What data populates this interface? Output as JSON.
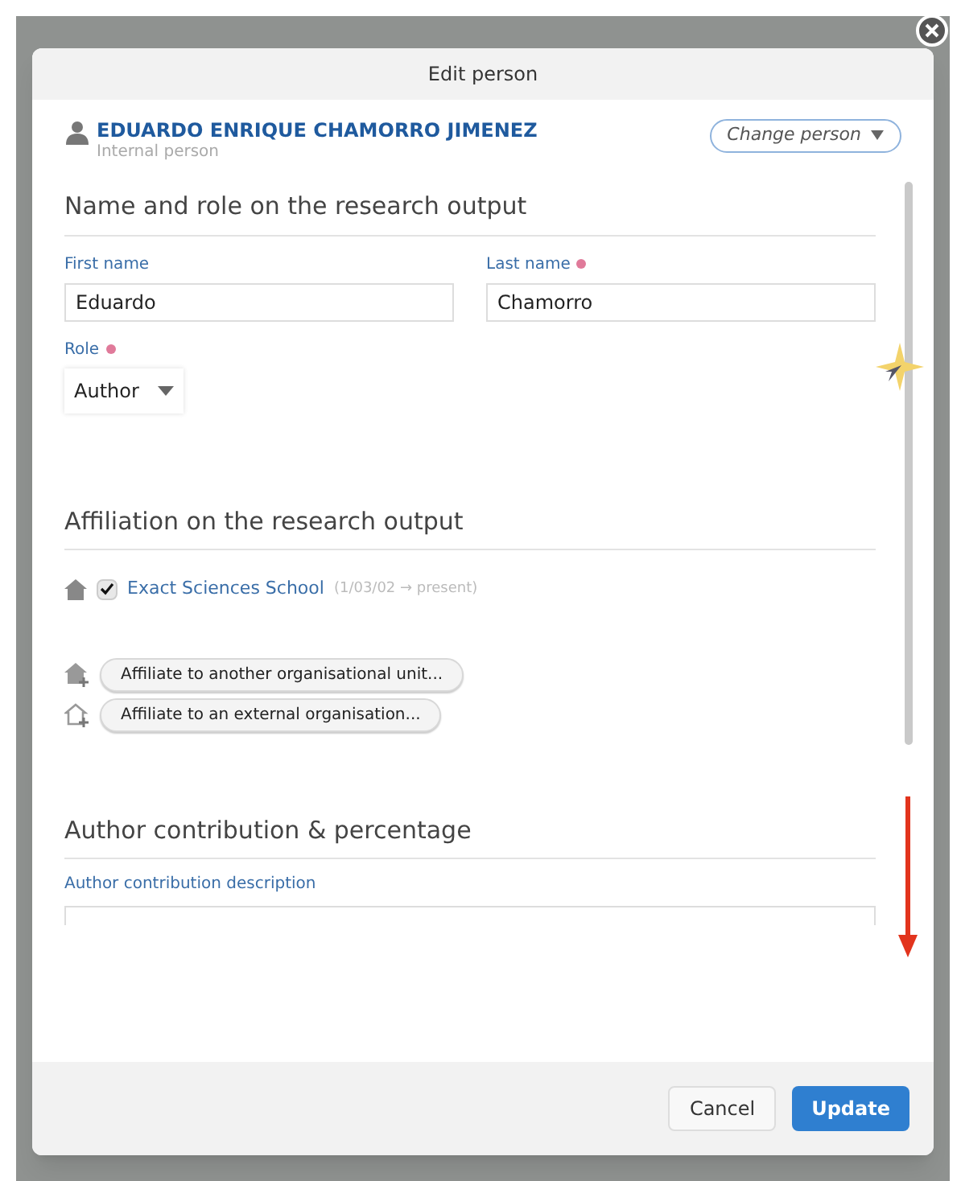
{
  "dialog": {
    "title": "Edit person"
  },
  "person": {
    "name": "EDUARDO ENRIQUE CHAMORRO JIMENEZ",
    "subtitle": "Internal person",
    "change_button": "Change person"
  },
  "name_section": {
    "heading": "Name and role on the research output",
    "fields": [
      {
        "label": "First name",
        "value": "Eduardo",
        "required": false
      },
      {
        "label": "Last name",
        "value": "Chamorro",
        "required": true
      }
    ],
    "role": {
      "label": "Role",
      "value": "Author",
      "required": true
    }
  },
  "affiliation_section": {
    "heading": "Affiliation on the research output",
    "affiliations": [
      {
        "name": "Exact Sciences School",
        "period": "(1/03/02 → present)",
        "checked": true
      }
    ],
    "actions": [
      {
        "kind": "internal",
        "label": "Affiliate to another organisational unit..."
      },
      {
        "kind": "external",
        "label": "Affiliate to an external organisation..."
      }
    ]
  },
  "contribution_section": {
    "heading": "Author contribution & percentage",
    "field_label": "Author contribution description"
  },
  "footer_buttons": [
    {
      "label": "Cancel",
      "kind": "secondary"
    },
    {
      "label": "Update",
      "kind": "primary"
    }
  ]
}
